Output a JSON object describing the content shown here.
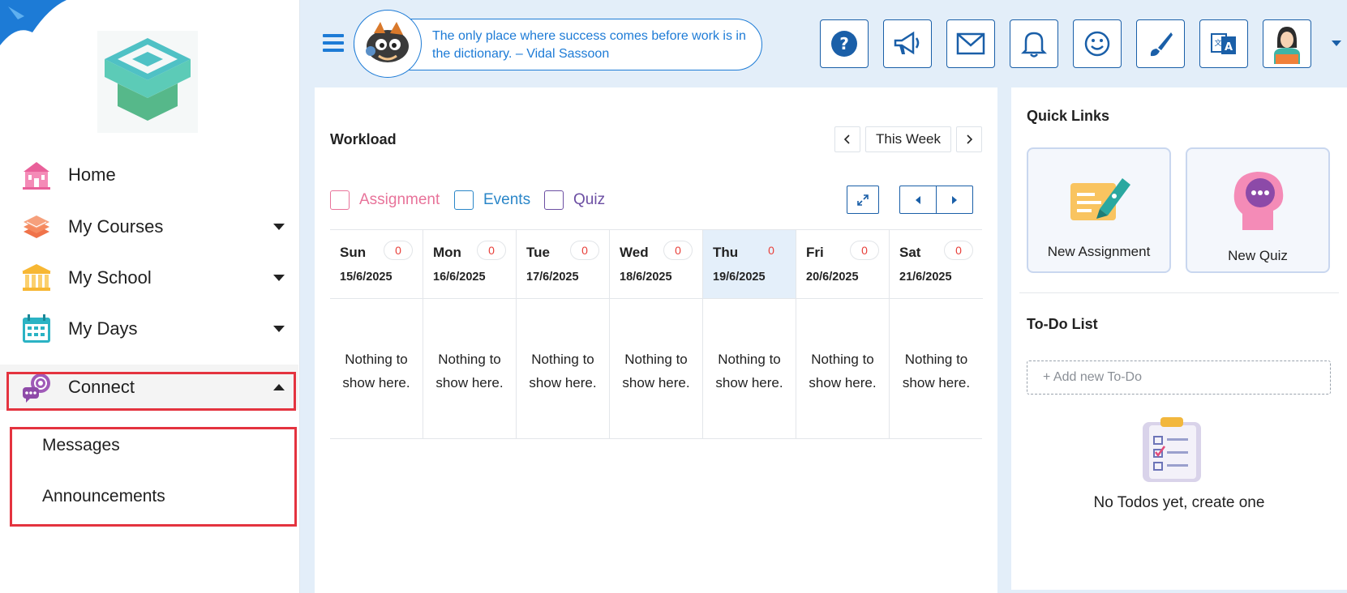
{
  "sidebar": {
    "items": [
      {
        "label": "Home",
        "icon": "school-building-icon"
      },
      {
        "label": "My Courses",
        "icon": "books-stack-icon"
      },
      {
        "label": "My School",
        "icon": "institution-icon"
      },
      {
        "label": "My Days",
        "icon": "calendar-icon"
      },
      {
        "label": "Connect",
        "icon": "chat-bubbles-icon"
      }
    ],
    "connect_submenu": [
      "Messages",
      "Announcements"
    ]
  },
  "header": {
    "quote": "The only place where success comes before work is in the dictionary. – Vidal Sassoon",
    "buttons": [
      "help-icon",
      "megaphone-icon",
      "mail-icon",
      "bell-icon",
      "smiley-icon",
      "paintbrush-icon",
      "translate-icon",
      "user-avatar-icon"
    ]
  },
  "workload": {
    "title": "Workload",
    "week_label": "This Week",
    "legend": [
      {
        "label": "Assignment",
        "color": "#e8739a"
      },
      {
        "label": "Events",
        "color": "#2a86c8"
      },
      {
        "label": "Quiz",
        "color": "#6c4fa3"
      }
    ],
    "days": [
      {
        "name": "Sun",
        "count": "0",
        "date": "15/6/2025",
        "empty": "Nothing to show here."
      },
      {
        "name": "Mon",
        "count": "0",
        "date": "16/6/2025",
        "empty": "Nothing to show here."
      },
      {
        "name": "Tue",
        "count": "0",
        "date": "17/6/2025",
        "empty": "Nothing to show here."
      },
      {
        "name": "Wed",
        "count": "0",
        "date": "18/6/2025",
        "empty": "Nothing to show here."
      },
      {
        "name": "Thu",
        "count": "0",
        "date": "19/6/2025",
        "empty": "Nothing to show here."
      },
      {
        "name": "Fri",
        "count": "0",
        "date": "20/6/2025",
        "empty": "Nothing to show here."
      },
      {
        "name": "Sat",
        "count": "0",
        "date": "21/6/2025",
        "empty": "Nothing to show here."
      }
    ]
  },
  "quick_links": {
    "title": "Quick Links",
    "new_assignment": "New Assignment",
    "new_quiz": "New Quiz"
  },
  "todo": {
    "title": "To-Do List",
    "placeholder": "+ Add new To-Do",
    "empty": "No Todos yet, create one"
  },
  "colors": {
    "accent": "#1d7bd6",
    "highlight": "#e4333f",
    "today": "#e4effa"
  }
}
